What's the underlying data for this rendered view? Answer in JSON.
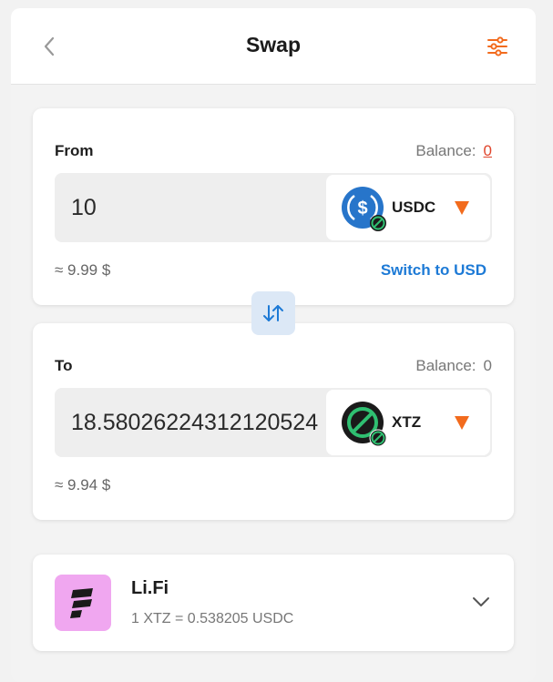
{
  "header": {
    "title": "Swap"
  },
  "from": {
    "label": "From",
    "balance_label": "Balance:",
    "balance_value": "0",
    "amount": "10",
    "token": "USDC",
    "usd_value": "≈ 9.99 $",
    "switch_label": "Switch to USD"
  },
  "to": {
    "label": "To",
    "balance_label": "Balance:",
    "balance_value": "0",
    "amount": "18.58026224312120524",
    "token": "XTZ",
    "usd_value": "≈ 9.94 $"
  },
  "route": {
    "provider": "Li.Fi",
    "rate": "1 XTZ = 0.538205 USDC"
  },
  "colors": {
    "accent_orange": "#f26b1d",
    "link_blue": "#1d7ad6",
    "balance_red": "#e0452c",
    "usdc_blue": "#2775ca",
    "xtz_green": "#2fbf71",
    "lifi_pink": "#f0a7f0"
  },
  "icons": {
    "back": "chevron-left-icon",
    "settings": "sliders-icon",
    "swap": "swap-arrows-icon",
    "dropdown": "caret-down-icon",
    "expand": "chevron-down-icon"
  }
}
